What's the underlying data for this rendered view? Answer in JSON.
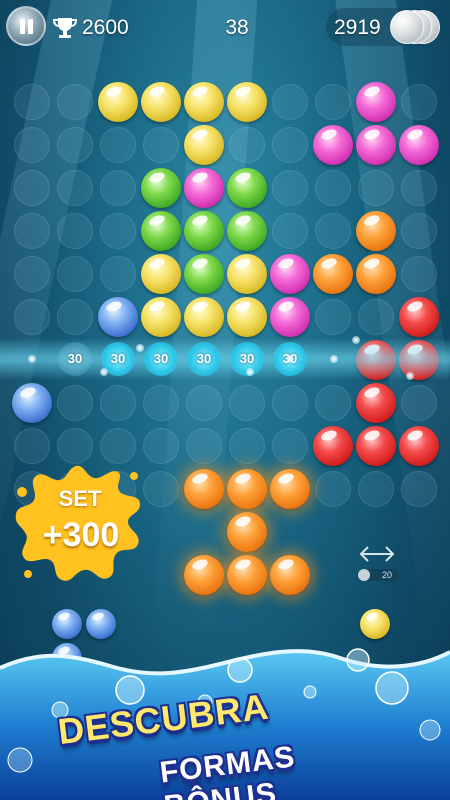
{
  "hud": {
    "best_score": "2600",
    "moves": "38",
    "coins": "2919"
  },
  "score_line": {
    "points": [
      "30",
      "30",
      "30",
      "30",
      "30",
      "30"
    ]
  },
  "bonus_popup": {
    "label": "SET",
    "points": "+300"
  },
  "swap": {
    "count": "20"
  },
  "promo": {
    "line1": "DESCUBRA",
    "line2": "FORMAS BÔNUS"
  },
  "colors": {
    "background": "#1b6a87",
    "beam": "#6fe3ff",
    "promo_yellow": "#ffe86b",
    "promo_outline": "#1d2f8f",
    "splash": "#ffc21f"
  },
  "icons": {
    "pause": "pause-icon",
    "trophy": "trophy-icon",
    "coins": "coin-stack-icon",
    "swap": "swap-arrows-icon"
  }
}
